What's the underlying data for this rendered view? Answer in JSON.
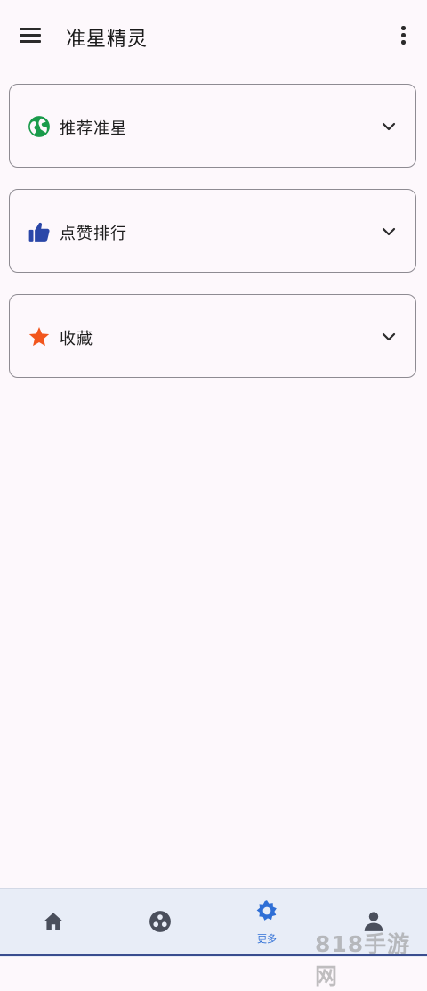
{
  "app_bar": {
    "title": "准星精灵",
    "menu_icon": "hamburger-menu-icon",
    "more_icon": "more-vert-icon"
  },
  "cards": [
    {
      "label": "推荐准星",
      "icon": "globe-icon",
      "icon_color": "#1a9b4b"
    },
    {
      "label": "点赞排行",
      "icon": "thumb-up-icon",
      "icon_color": "#2a47a8"
    },
    {
      "label": "收藏",
      "icon": "star-icon",
      "icon_color": "#f2561d"
    }
  ],
  "bottom_nav": {
    "items": [
      {
        "icon": "home-icon",
        "label": ""
      },
      {
        "icon": "crosshair-icon",
        "label": ""
      },
      {
        "icon": "gear-icon",
        "label": "更多",
        "active": true
      },
      {
        "icon": "person-icon",
        "label": ""
      }
    ],
    "active_color": "#2f6fd6",
    "inactive_color": "#4a4f5c"
  },
  "watermark": "818手游网"
}
